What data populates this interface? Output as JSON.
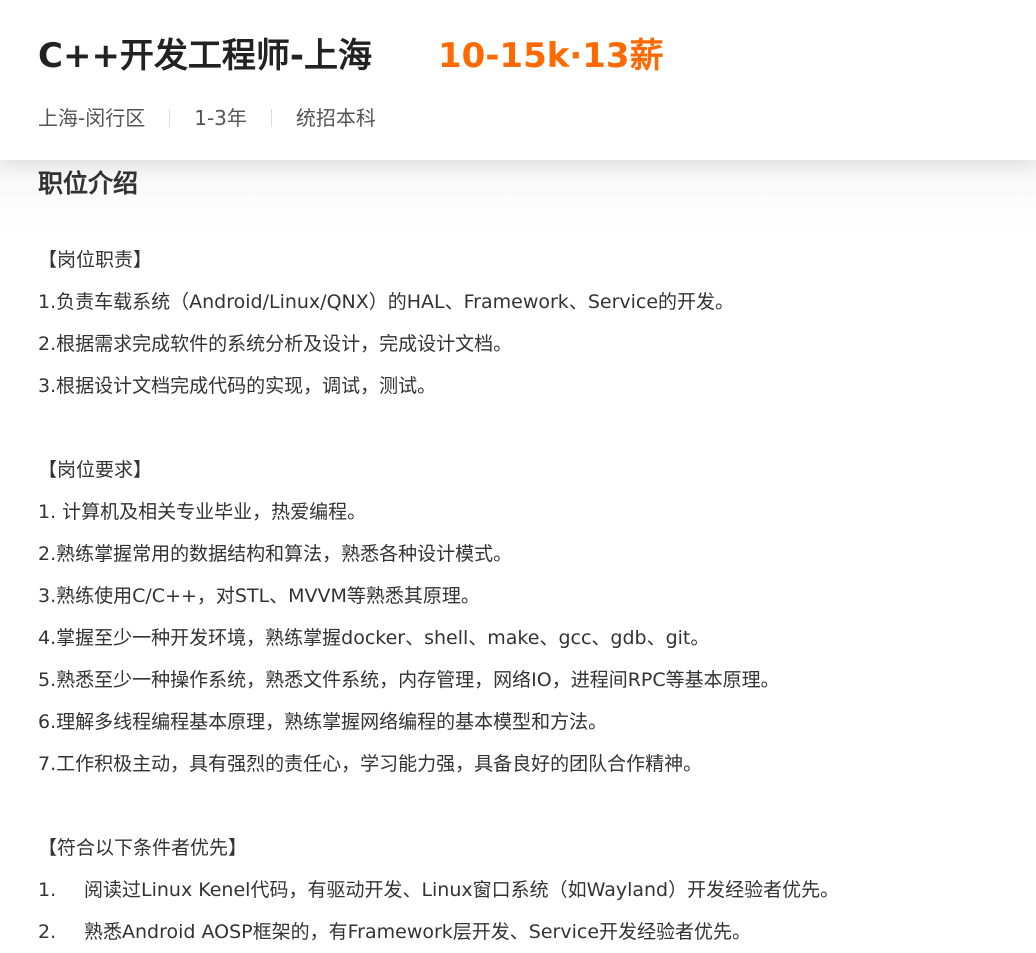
{
  "header": {
    "title": "C++开发工程师-上海",
    "salary": "10-15k·13薪",
    "location": "上海-闵行区",
    "experience": "1-3年",
    "education": "统招本科"
  },
  "colors": {
    "salary": "#ff6a00",
    "text": "#333333"
  },
  "description": {
    "section_title": "职位介绍",
    "duties_heading": "【岗位职责】",
    "duties": [
      "1.负责车载系统（Android/Linux/QNX）的HAL、Framework、Service的开发。",
      "2.根据需求完成软件的系统分析及设计，完成设计文档。",
      "3.根据设计文档完成代码的实现，调试，测试。"
    ],
    "requirements_heading": "【岗位要求】",
    "requirements": [
      "1. 计算机及相关专业毕业，热爱编程。",
      "2.熟练掌握常用的数据结构和算法，熟悉各种设计模式。",
      "3.熟练使用C/C++，对STL、MVVM等熟悉其原理。",
      "4.掌握至少一种开发环境，熟练掌握docker、shell、make、gcc、gdb、git。",
      "5.熟悉至少一种操作系统，熟悉文件系统，内存管理，网络IO，进程间RPC等基本原理。",
      "6.理解多线程编程基本原理，熟练掌握网络编程的基本模型和方法。",
      "7.工作积极主动，具有强烈的责任心，学习能力强，具备良好的团队合作精神。"
    ],
    "preferred_heading": "【符合以下条件者优先】",
    "preferred": [
      {
        "num": "1.",
        "text": "阅读过Linux Kenel代码，有驱动开发、Linux窗口系统（如Wayland）开发经验者优先。"
      },
      {
        "num": "2.",
        "text": "熟悉Android AOSP框架的，有Framework层开发、Service开发经验者优先。"
      }
    ]
  }
}
